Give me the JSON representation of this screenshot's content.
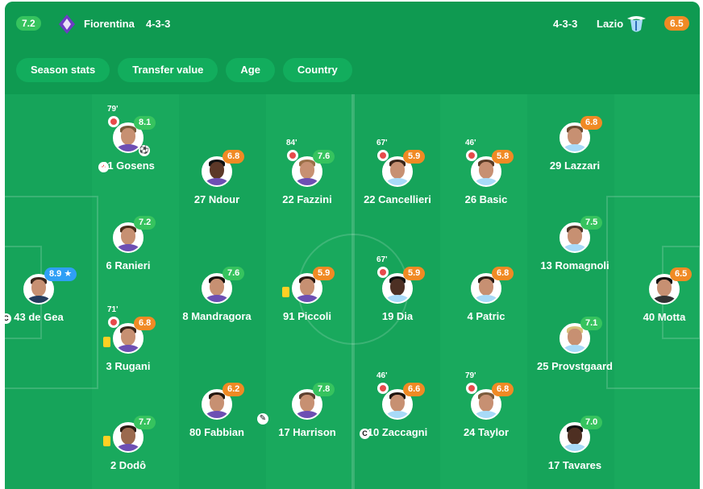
{
  "home": {
    "rating": "7.2",
    "name": "Fiorentina",
    "formation": "4-3-3",
    "rating_color": "#36c35e",
    "crest_color": "#6d3cc4"
  },
  "away": {
    "rating": "6.5",
    "name": "Lazio",
    "formation": "4-3-3",
    "rating_color": "#f08a24",
    "crest_color": "#a8daf8"
  },
  "tabs": [
    "Season stats",
    "Transfer value",
    "Age",
    "Country"
  ],
  "players": [
    {
      "name": "43 de Gea",
      "rating": "8.9 ★",
      "color": "blue",
      "marker": "C"
    },
    {
      "name": "21 Gosens",
      "rating": "8.1",
      "color": "green",
      "subtime": "79'",
      "sub": true,
      "event": "⚽",
      "marker": "+"
    },
    {
      "name": "6 Ranieri",
      "rating": "7.2",
      "color": "green"
    },
    {
      "name": "3 Rugani",
      "rating": "6.8",
      "color": "orange",
      "subtime": "71'",
      "sub": true,
      "yellow": true
    },
    {
      "name": "2 Dodô",
      "rating": "7.7",
      "color": "green",
      "yellow": true
    },
    {
      "name": "27 Ndour",
      "rating": "6.8",
      "color": "orange"
    },
    {
      "name": "8 Mandragora",
      "rating": "7.6",
      "color": "green"
    },
    {
      "name": "80 Fabbian",
      "rating": "6.2",
      "color": "orange"
    },
    {
      "name": "22 Fazzini",
      "rating": "7.6",
      "color": "green",
      "subtime": "84'",
      "sub": true
    },
    {
      "name": "91 Piccoli",
      "rating": "5.9",
      "color": "orange",
      "yellow": true
    },
    {
      "name": "17 Harrison",
      "rating": "7.8",
      "color": "green",
      "event": "✎"
    },
    {
      "name": "22 Cancellieri",
      "rating": "5.9",
      "color": "orange",
      "subtime": "67'",
      "sub": true
    },
    {
      "name": "19 Dia",
      "rating": "5.9",
      "color": "orange",
      "subtime": "67'",
      "sub": true
    },
    {
      "name": "10 Zaccagni",
      "rating": "6.6",
      "color": "orange",
      "subtime": "46'",
      "sub": true,
      "marker": "C"
    },
    {
      "name": "26 Basic",
      "rating": "5.8",
      "color": "orange",
      "subtime": "46'",
      "sub": true
    },
    {
      "name": "4 Patric",
      "rating": "6.8",
      "color": "orange"
    },
    {
      "name": "24 Taylor",
      "rating": "6.8",
      "color": "orange",
      "subtime": "79'",
      "sub": true
    },
    {
      "name": "29 Lazzari",
      "rating": "6.8",
      "color": "orange"
    },
    {
      "name": "13 Romagnoli",
      "rating": "7.5",
      "color": "green"
    },
    {
      "name": "25 Provstgaard",
      "rating": "7.1",
      "color": "green"
    },
    {
      "name": "17 Tavares",
      "rating": "7.0",
      "color": "green"
    },
    {
      "name": "40 Motta",
      "rating": "6.5",
      "color": "orange"
    }
  ]
}
